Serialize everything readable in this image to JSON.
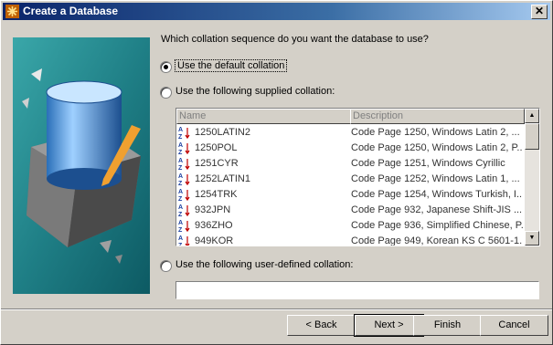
{
  "window": {
    "title": "Create a Database",
    "close_glyph": "✕"
  },
  "wizard": {
    "question": "Which collation sequence do you want the database to use?",
    "options": [
      {
        "label": "Use the default collation",
        "checked": true
      },
      {
        "label": "Use the following supplied collation:",
        "checked": false
      },
      {
        "label": "Use the following user-defined collation:",
        "checked": false
      }
    ],
    "columns": [
      "Name",
      "Description"
    ],
    "rows": [
      {
        "name": "1250LATIN2",
        "desc": "Code Page 1250, Windows Latin 2, ..."
      },
      {
        "name": "1250POL",
        "desc": "Code Page 1250, Windows Latin 2, P..."
      },
      {
        "name": "1251CYR",
        "desc": "Code Page 1251, Windows Cyrillic"
      },
      {
        "name": "1252LATIN1",
        "desc": "Code Page 1252, Windows Latin 1, ..."
      },
      {
        "name": "1254TRK",
        "desc": "Code Page 1254, Windows Turkish, I..."
      },
      {
        "name": "932JPN",
        "desc": "Code Page 932, Japanese Shift-JIS ..."
      },
      {
        "name": "936ZHO",
        "desc": "Code Page 936, Simplified Chinese, P..."
      },
      {
        "name": "949KOR",
        "desc": "Code Page 949, Korean KS C 5601-1..."
      }
    ],
    "user_defined_value": ""
  },
  "buttons": {
    "back": "< Back",
    "next": "Next >",
    "finish": "Finish",
    "cancel": "Cancel"
  }
}
